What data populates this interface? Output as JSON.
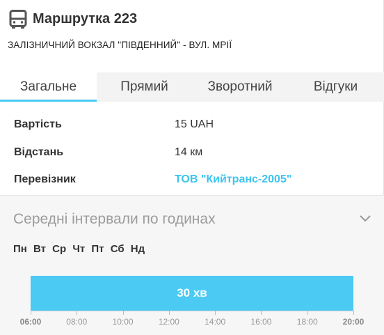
{
  "header": {
    "title": "Маршрутка 223",
    "route": "ЗАЛІЗНИЧНИЙ ВОКЗАЛ \"ПІВДЕННИЙ\" - ВУЛ. МРІЇ",
    "icon": "bus-icon"
  },
  "tabs": [
    {
      "label": "Загальне",
      "active": true
    },
    {
      "label": "Прямий",
      "active": false
    },
    {
      "label": "Зворотний",
      "active": false
    },
    {
      "label": "Відгуки",
      "active": false
    }
  ],
  "info": [
    {
      "label": "Вартість",
      "value": "15 UAH"
    },
    {
      "label": "Відстань",
      "value": "14 км"
    },
    {
      "label": "Перевізник",
      "value": "ТОВ \"Кийтранс-2005\""
    }
  ],
  "intervals": {
    "title": "Середні інтервали по годинах",
    "days": [
      "Пн",
      "Вт",
      "Ср",
      "Чт",
      "Пт",
      "Сб",
      "Нд"
    ],
    "bar_label": "30 хв",
    "hours": [
      "06:00",
      "08:00",
      "10:00",
      "12:00",
      "14:00",
      "16:00",
      "18:00",
      "20:00"
    ]
  },
  "colors": {
    "accent": "#49c9f2",
    "link": "#3cc4ee",
    "bar": "#4bcaf3"
  }
}
